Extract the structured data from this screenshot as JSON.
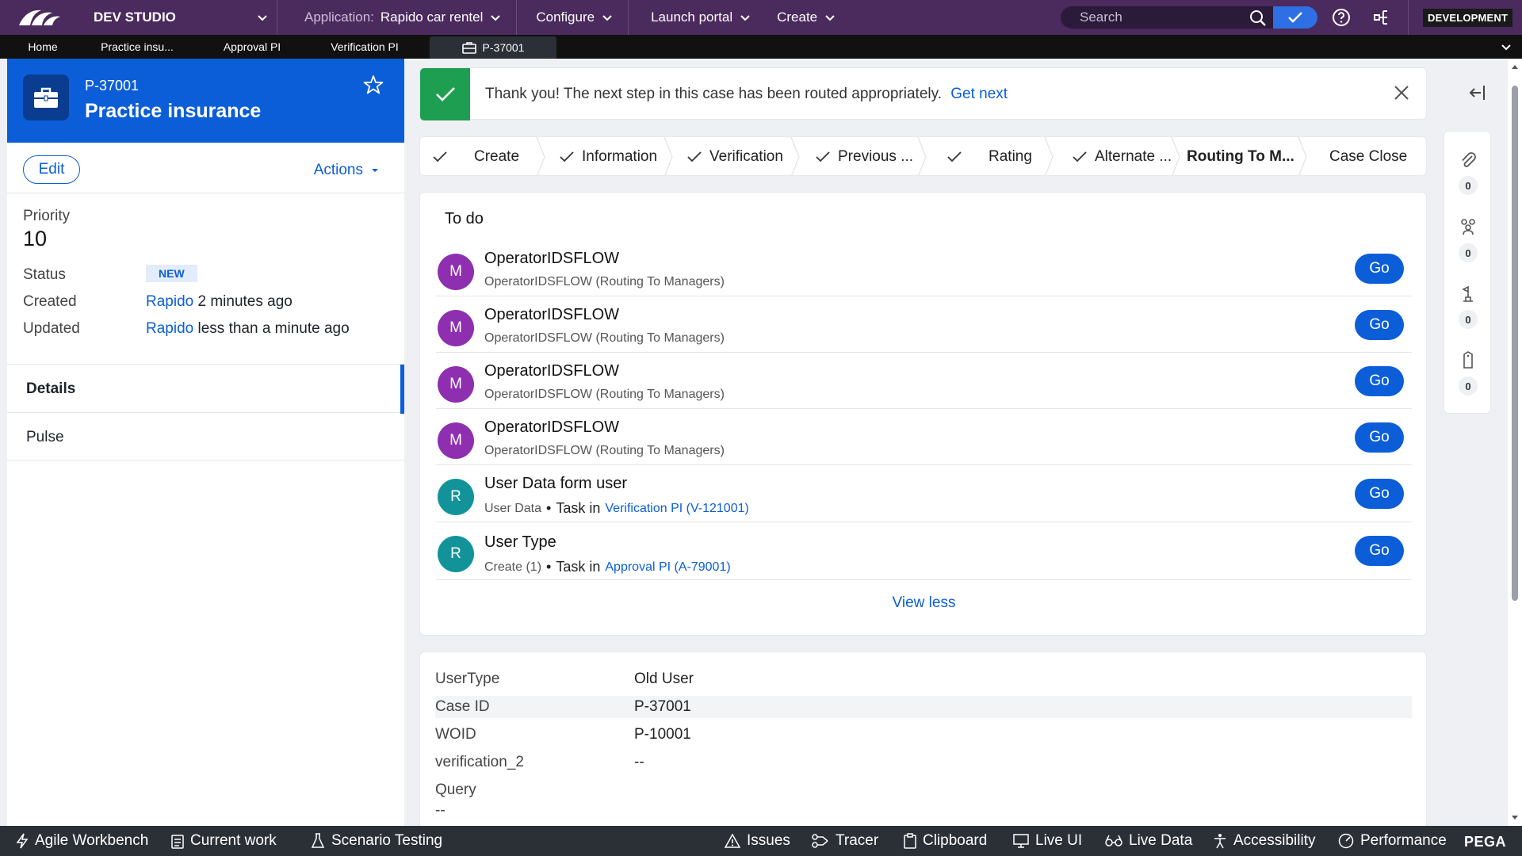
{
  "topbar": {
    "studio": "DEV STUDIO",
    "application_label": "Application:",
    "application_name": "Rapido car rentel",
    "configure": "Configure",
    "launch_portal": "Launch portal",
    "create": "Create",
    "search_placeholder": "Search",
    "environment": "DEVELOPMENT",
    "icons": [
      "pega-logo-icon",
      "chevron-down-icon",
      "search-icon",
      "check-icon",
      "help-icon",
      "share-icon"
    ]
  },
  "tabs": [
    {
      "label": "Home"
    },
    {
      "label": "Practice insu..."
    },
    {
      "label": "Approval PI"
    },
    {
      "label": "Verification PI"
    },
    {
      "label": "P-37001",
      "active": true
    }
  ],
  "case": {
    "id": "P-37001",
    "title": "Practice insurance",
    "edit": "Edit",
    "actions": "Actions",
    "priority_label": "Priority",
    "priority_value": "10",
    "status_label": "Status",
    "status_value": "NEW",
    "created_label": "Created",
    "created_by": "Rapido",
    "created_time": "2 minutes ago",
    "updated_label": "Updated",
    "updated_by": "Rapido",
    "updated_time": "less than a minute ago",
    "tab_details": "Details",
    "tab_pulse": "Pulse"
  },
  "banner": {
    "message": "Thank you! The next step in this case has been routed appropriately.",
    "link": "Get next"
  },
  "stages": [
    {
      "label": "Create",
      "done": true
    },
    {
      "label": "Information",
      "done": true
    },
    {
      "label": "Verification",
      "done": true
    },
    {
      "label": "Previous ...",
      "done": true
    },
    {
      "label": "Rating",
      "done": true
    },
    {
      "label": "Alternate ...",
      "done": true
    },
    {
      "label": "Routing To M...",
      "current": true
    },
    {
      "label": "Case Close"
    }
  ],
  "todo": {
    "title": "To do",
    "go": "Go",
    "view_less": "View less",
    "task_in": "Task in",
    "bullet": "•",
    "items": [
      {
        "initial": "M",
        "title": "OperatorIDSFLOW",
        "subtitle": "OperatorIDSFLOW (Routing To Managers)",
        "color": "#8e2fb0"
      },
      {
        "initial": "M",
        "title": "OperatorIDSFLOW",
        "subtitle": "OperatorIDSFLOW (Routing To Managers)",
        "color": "#8e2fb0"
      },
      {
        "initial": "M",
        "title": "OperatorIDSFLOW",
        "subtitle": "OperatorIDSFLOW (Routing To Managers)",
        "color": "#8e2fb0"
      },
      {
        "initial": "M",
        "title": "OperatorIDSFLOW",
        "subtitle": "OperatorIDSFLOW (Routing To Managers)",
        "color": "#8e2fb0"
      },
      {
        "initial": "R",
        "title": "User Data form user",
        "subtitle": "User Data",
        "link": "Verification PI (V-121001)",
        "color": "#12939a"
      },
      {
        "initial": "R",
        "title": "User Type",
        "subtitle": "Create (1)",
        "link": "Approval PI (A-79001)",
        "color": "#12939a"
      }
    ]
  },
  "fields": [
    {
      "label": "UserType",
      "value": "Old User"
    },
    {
      "label": "Case ID",
      "value": "P-37001"
    },
    {
      "label": "WOID",
      "value": "P-10001"
    },
    {
      "label": "verification_2",
      "value": "--"
    },
    {
      "label": "Query",
      "value": "--"
    }
  ],
  "utility": {
    "counts": [
      "0",
      "0",
      "0",
      "0"
    ],
    "icons": [
      "attachment-icon",
      "followers-icon",
      "stakeholders-icon",
      "tags-icon"
    ]
  },
  "bottombar": {
    "items": [
      "Agile Workbench",
      "Current work",
      "Scenario Testing",
      "Issues",
      "Tracer",
      "Clipboard",
      "Live UI",
      "Live Data",
      "Accessibility",
      "Performance"
    ],
    "brand": "PEGA"
  },
  "colors": {
    "topbar": "#4b2a5e",
    "accent": "#0b5ed7",
    "success": "#1e9e50",
    "operator_avatar": "#8e2fb0",
    "user_avatar": "#12939a"
  }
}
